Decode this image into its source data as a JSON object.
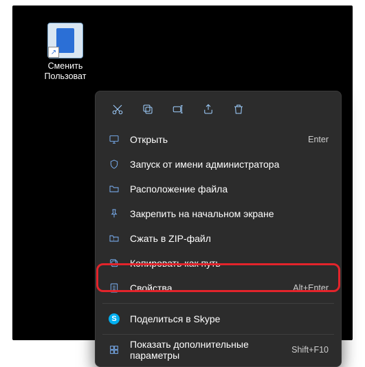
{
  "shortcut": {
    "label_line1": "Сменить",
    "label_line2": "Пользоват"
  },
  "action_bar": [
    {
      "name": "cut-icon"
    },
    {
      "name": "copy-icon"
    },
    {
      "name": "rename-icon"
    },
    {
      "name": "share-icon"
    },
    {
      "name": "delete-icon"
    }
  ],
  "menu": {
    "items": [
      {
        "name": "open",
        "icon": "monitor-icon",
        "label": "Открыть",
        "accel": "Enter"
      },
      {
        "name": "run-admin",
        "icon": "shield-icon",
        "label": "Запуск от имени администратора",
        "accel": ""
      },
      {
        "name": "open-loc",
        "icon": "folder-icon",
        "label": "Расположение файла",
        "accel": ""
      },
      {
        "name": "pin-start",
        "icon": "pin-icon",
        "label": "Закрепить на начальном экране",
        "accel": ""
      },
      {
        "name": "zip",
        "icon": "archive-icon",
        "label": "Сжать в ZIP-файл",
        "accel": ""
      },
      {
        "name": "copy-path",
        "icon": "copypath-icon",
        "label": "Копировать как путь",
        "accel": ""
      },
      {
        "name": "properties",
        "icon": "props-icon",
        "label": "Свойства",
        "accel": "Alt+Enter"
      }
    ],
    "skype": {
      "icon": "skype-icon",
      "label": "Поделиться в Skype",
      "glyph": "S"
    },
    "more": {
      "icon": "more-icon",
      "label": "Показать дополнительные параметры",
      "accel": "Shift+F10"
    }
  }
}
